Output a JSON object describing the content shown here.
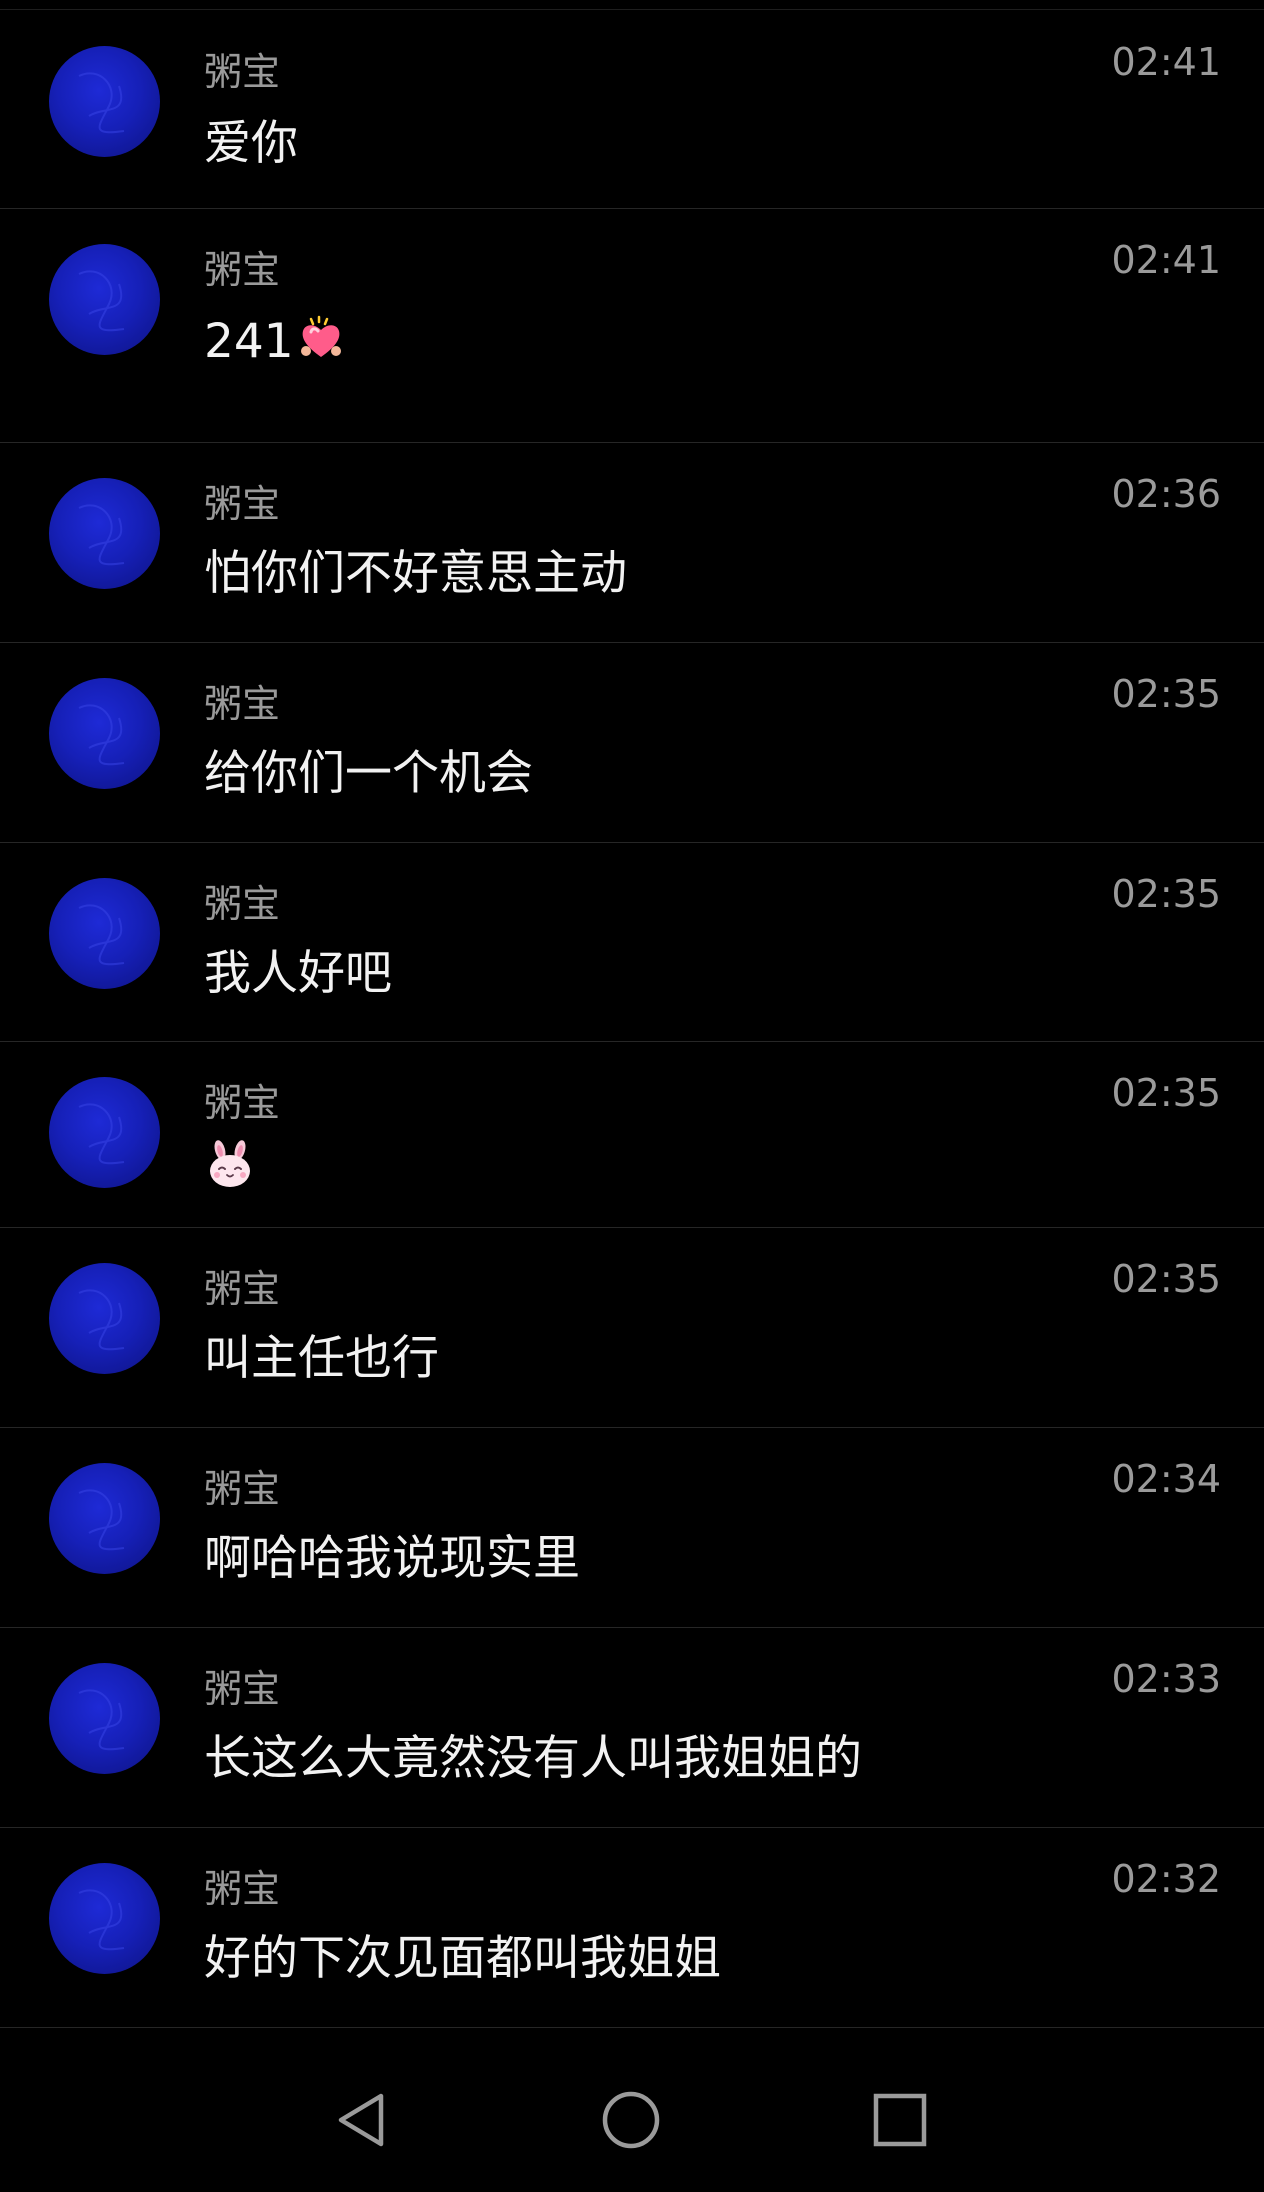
{
  "conversation": {
    "messages": [
      {
        "sender": "粥宝",
        "time": "02:41",
        "text": "爱你",
        "emoji": ""
      },
      {
        "sender": "粥宝",
        "time": "02:41",
        "text": "241",
        "emoji": "heart-sticker-icon"
      },
      {
        "sender": "粥宝",
        "time": "02:36",
        "text": "怕你们不好意思主动",
        "emoji": ""
      },
      {
        "sender": "粥宝",
        "time": "02:35",
        "text": "给你们一个机会",
        "emoji": ""
      },
      {
        "sender": "粥宝",
        "time": "02:35",
        "text": "我人好吧",
        "emoji": ""
      },
      {
        "sender": "粥宝",
        "time": "02:35",
        "text": "",
        "emoji": "bunny-sticker-icon"
      },
      {
        "sender": "粥宝",
        "time": "02:35",
        "text": "叫主任也行",
        "emoji": ""
      },
      {
        "sender": "粥宝",
        "time": "02:34",
        "text": "啊哈哈我说现实里",
        "emoji": ""
      },
      {
        "sender": "粥宝",
        "time": "02:33",
        "text": "长这么大竟然没有人叫我姐姐的",
        "emoji": ""
      },
      {
        "sender": "粥宝",
        "time": "02:32",
        "text": "好的下次见面都叫我姐姐",
        "emoji": ""
      }
    ]
  },
  "navbar": {
    "back_icon": "triangle-back-icon",
    "home_icon": "circle-home-icon",
    "recents_icon": "square-recents-icon"
  },
  "colors": {
    "background": "#000000",
    "avatar": "#1620b8",
    "secondary_text": "#9a9a9a",
    "primary_text": "#f2f2f2",
    "divider": "#262626"
  }
}
